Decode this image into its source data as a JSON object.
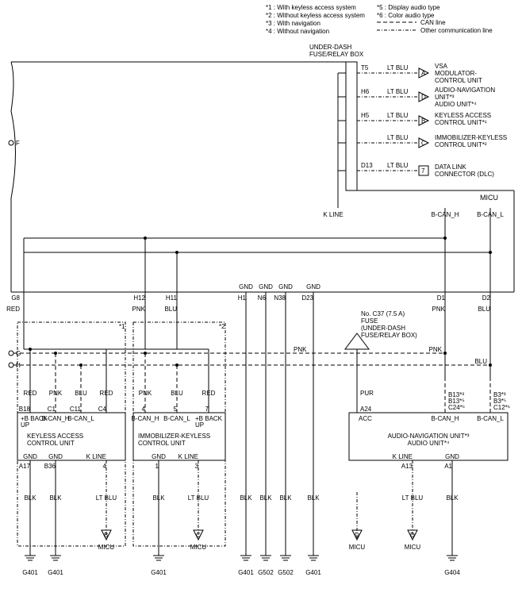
{
  "legend": {
    "n1": "*1 : With keyless access system",
    "n2": "*2 : Without keyless access system",
    "n3": "*3 : With navigation",
    "n4": "*4 : Without navigation",
    "n5": "*5 : Display audio type",
    "n6": "*6 : Color audio type",
    "can": "CAN line",
    "other": "Other communication line"
  },
  "header": {
    "box": "UNDER-DASH\nFUSE/RELAY BOX",
    "micu": "MICU"
  },
  "right_units": {
    "u1": {
      "pin": "T5",
      "wire": "LT BLU",
      "sym": "A",
      "label": "VSA\nMODULATOR-\nCONTROL UNIT"
    },
    "u2": {
      "pin": "H6",
      "wire": "LT BLU",
      "sym": "D",
      "label": "AUDIO-NAVIGATION\nUNIT*³\nAUDIO UNIT*⁴"
    },
    "u3": {
      "pin": "H5",
      "wire": "LT BLU",
      "sym": "B",
      "label": "KEYLESS ACCESS\nCONTROL UNIT*¹"
    },
    "u4": {
      "pin": "",
      "wire": "LT BLU",
      "sym": "C",
      "label": "IMMOBILIZER-KEYLESS\nCONTROL UNIT*²"
    },
    "u5": {
      "pin": "D13",
      "wire": "LT BLU",
      "sym": "7",
      "label": "DATA LINK\nCONNECTOR (DLC)"
    }
  },
  "bus_labels": {
    "kline": "K LINE",
    "bcanh": "B-CAN_H",
    "bcanl": "B-CAN_L"
  },
  "top_pins": {
    "g8": {
      "pin": "G8",
      "wire": "RED"
    },
    "h12": {
      "pin": "H12",
      "wire": "PNK"
    },
    "h11": {
      "pin": "H11",
      "wire": "BLU"
    },
    "h1": {
      "pin": "H1",
      "lbl": "GND"
    },
    "n6": {
      "pin": "N6",
      "lbl": "GND"
    },
    "n38": {
      "pin": "N38",
      "lbl": "GND"
    },
    "d23": {
      "pin": "D23",
      "lbl": "GND"
    },
    "d1": {
      "pin": "D1",
      "wire": "PNK"
    },
    "d2": {
      "pin": "D2",
      "wire": "BLU"
    }
  },
  "fuse": {
    "label": "No. C37 (7.5 A)\nFUSE\n(UNDER-DASH\nFUSE/RELAY BOX)"
  },
  "mid_wires": {
    "pnk": "PNK",
    "blu": "BLU",
    "pur": "PUR"
  },
  "block_keyless": {
    "title": "KEYLESS ACCESS\nCONTROL UNIT",
    "top": [
      {
        "pin": "B18",
        "wire": "RED",
        "lbl": "+B BACK\nUP"
      },
      {
        "pin": "C1",
        "wire": "PNK",
        "lbl": "B-CAN_H"
      },
      {
        "pin": "C11",
        "wire": "BLU",
        "lbl": "B-CAN_L"
      },
      {
        "pin": "C4",
        "wire": "RED"
      }
    ],
    "bot": [
      {
        "pin": "A17",
        "lbl": "GND"
      },
      {
        "pin": "B36",
        "lbl": "GND"
      },
      {
        "pin": "4",
        "lbl": "K LINE"
      }
    ],
    "gnd": [
      {
        "pin": "G401",
        "wire": "BLK"
      },
      {
        "pin": "G401",
        "wire": "BLK"
      },
      {
        "pin": "MICU",
        "wire": "LT BLU",
        "sym": "B"
      }
    ],
    "side": "F",
    "sideG": "G",
    "sideH": "H",
    "tag": "*1"
  },
  "block_immob": {
    "title": "IMMOBILIZER-KEYLESS\nCONTROL UNIT",
    "top": [
      {
        "pin": "4",
        "wire": "PNK",
        "lbl": "B-CAN_H"
      },
      {
        "pin": "5",
        "wire": "BLU",
        "lbl": "B-CAN_L"
      },
      {
        "pin": "7",
        "wire": "RED",
        "lbl": "+B BACK\nUP"
      }
    ],
    "bot": [
      {
        "pin": "1",
        "lbl": "GND"
      },
      {
        "pin": "3",
        "lbl": "K LINE"
      }
    ],
    "gnd": [
      {
        "pin": "G401",
        "wire": "BLK"
      },
      {
        "pin": "MICU",
        "wire": "LT BLU",
        "sym": "C"
      }
    ],
    "tag": "*2"
  },
  "center_gnd": [
    {
      "pin": "G401",
      "wire": "BLK"
    },
    {
      "pin": "G502",
      "wire": "BLK"
    },
    {
      "pin": "G502",
      "wire": "BLK"
    },
    {
      "pin": "G401",
      "wire": "BLK"
    }
  ],
  "micu_center": {
    "wire": "PUR",
    "sym": "D",
    "label": "MICU",
    "pin": "A24",
    "acc": "ACC"
  },
  "block_audio": {
    "title": "AUDIO-NAVIGATION UNIT*³\nAUDIO UNIT*⁴",
    "top_right": [
      {
        "pin": "B13*³",
        "alt": "B13*⁵",
        "alt2": "C24*⁶",
        "lbl": "B-CAN_H"
      },
      {
        "pin": "B3*³",
        "alt": "B3*⁵",
        "alt2": "C12*⁶",
        "lbl": "B-CAN_L"
      }
    ],
    "bot": [
      {
        "pin": "A13",
        "lbl": "K LINE",
        "wire": "LT BLU"
      },
      {
        "pin": "A1",
        "lbl": "GND",
        "wire": "BLK"
      }
    ],
    "gnd": {
      "pin": "G404"
    },
    "micu": {
      "sym": "D",
      "label": "MICU"
    }
  }
}
